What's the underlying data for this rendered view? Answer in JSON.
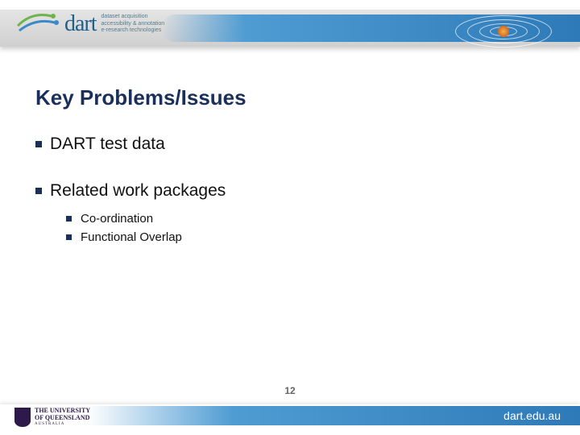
{
  "header": {
    "logo_text": "dart",
    "logo_tag_l1": "dataset acquisition",
    "logo_tag_l2": "accessibility & annotation",
    "logo_tag_l3": "e-research technologies"
  },
  "slide": {
    "title": "Key Problems/Issues",
    "bullets": [
      {
        "text": "DART test data",
        "sub": []
      },
      {
        "text": "Related work packages",
        "sub": [
          {
            "text": "Co-ordination"
          },
          {
            "text": "Functional Overlap"
          }
        ]
      }
    ],
    "page_number": "12"
  },
  "footer": {
    "uq_line1": "THE UNIVERSITY",
    "uq_line2": "OF QUEENSLAND",
    "uq_line3": "AUSTRALIA",
    "url": "dart.edu.au"
  }
}
